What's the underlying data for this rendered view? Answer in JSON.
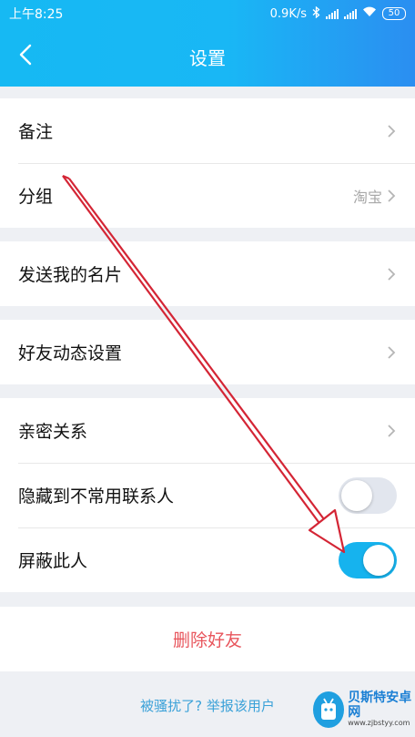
{
  "status_bar": {
    "time": "上午8:25",
    "speed": "0.9K/s",
    "battery": "50"
  },
  "nav": {
    "title": "设置"
  },
  "sections": [
    {
      "items": [
        {
          "label": "备注",
          "value": ""
        },
        {
          "label": "分组",
          "value": "淘宝"
        }
      ]
    },
    {
      "items": [
        {
          "label": "发送我的名片",
          "value": ""
        }
      ]
    },
    {
      "items": [
        {
          "label": "好友动态设置",
          "value": ""
        }
      ]
    },
    {
      "items": [
        {
          "label": "亲密关系",
          "value": ""
        },
        {
          "label": "隐藏到不常用联系人",
          "toggle": false
        },
        {
          "label": "屏蔽此人",
          "toggle": true
        }
      ]
    }
  ],
  "delete_label": "删除好友",
  "report_text": "被骚扰了? 举报该用户",
  "watermark": {
    "cn": "贝斯特安卓网",
    "url": "www.zjbstyy.com"
  },
  "colors": {
    "header_start": "#16b9f3",
    "header_end": "#2b8ef1",
    "toggle_on": "#16b3ee",
    "danger": "#e8555c",
    "link": "#3aa1d8",
    "arrow": "#d42535"
  }
}
